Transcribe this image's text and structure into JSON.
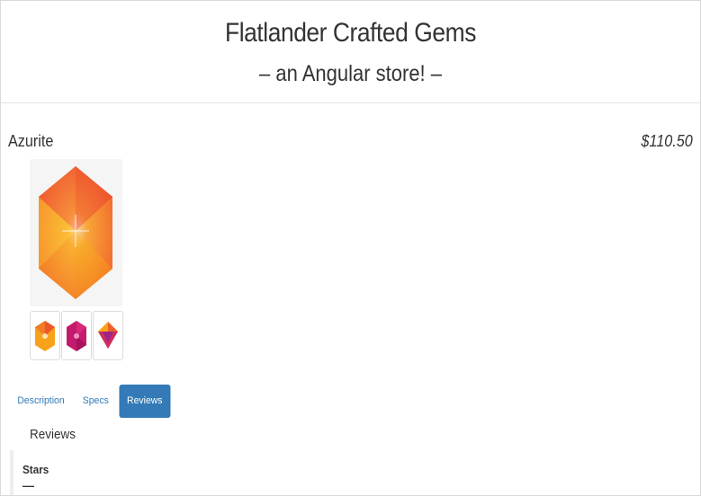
{
  "header": {
    "title": "Flatlander Crafted Gems",
    "subtitle": "– an Angular store! –"
  },
  "product": {
    "name": "Azurite",
    "price": "$110.50",
    "main_image_icon": "orange-hexagon-gem-icon",
    "thumbnails": [
      {
        "icon": "orange-hexagon-gem-icon"
      },
      {
        "icon": "magenta-hexagon-gem-icon"
      },
      {
        "icon": "orange-diamond-gem-icon"
      }
    ]
  },
  "tabs": [
    {
      "label": "Description",
      "active": false
    },
    {
      "label": "Specs",
      "active": false
    },
    {
      "label": "Reviews",
      "active": true
    }
  ],
  "reviews": {
    "heading": "Reviews",
    "stars_label": "Stars",
    "stars_value": "—"
  },
  "colors": {
    "accent": "#337ab7",
    "gem_orange": "#f7a21a",
    "gem_red": "#e8452e",
    "gem_magenta": "#c4196c"
  }
}
